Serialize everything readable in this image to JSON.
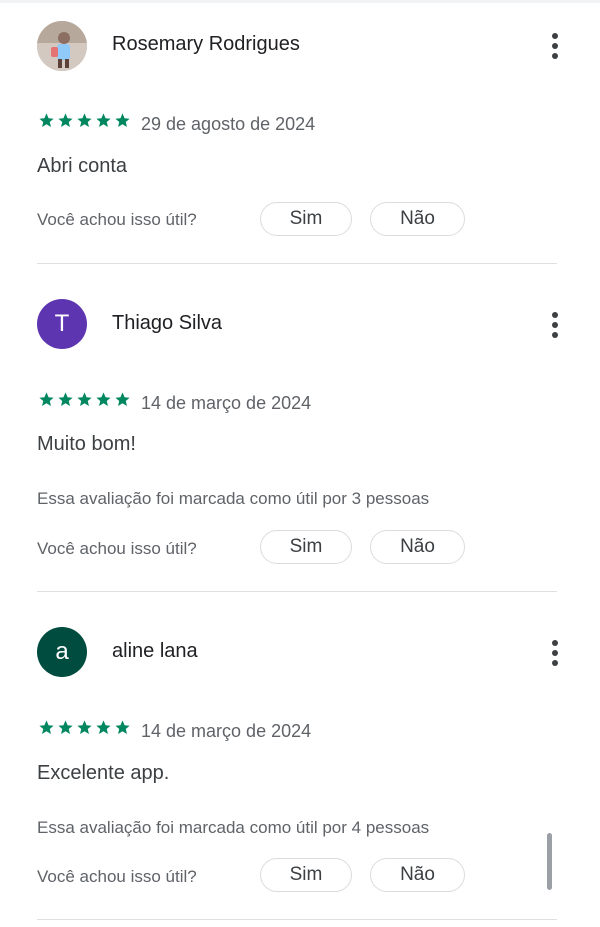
{
  "colors": {
    "star": "#01875f",
    "avatar_thiago": "#5e35b1",
    "avatar_aline": "#004d40",
    "text_secondary": "#5f6368"
  },
  "reviews": [
    {
      "author": "Rosemary Rodrigues",
      "avatar_type": "photo",
      "rating": 5,
      "date": "29 de agosto de 2024",
      "text": "Abri conta",
      "helpful_count_text": "",
      "helpful_question": "Você achou isso útil?",
      "yes_label": "Sim",
      "no_label": "Não"
    },
    {
      "author": "Thiago Silva",
      "avatar_letter": "T",
      "rating": 5,
      "date": "14 de março de 2024",
      "text": "Muito bom!",
      "helpful_count_text": "Essa avaliação foi marcada como útil por 3 pessoas",
      "helpful_question": "Você achou isso útil?",
      "yes_label": "Sim",
      "no_label": "Não"
    },
    {
      "author": "aline lana",
      "avatar_letter": "a",
      "rating": 5,
      "date": "14 de março de 2024",
      "text": "Excelente app.",
      "helpful_count_text": "Essa avaliação foi marcada como útil por 4 pessoas",
      "helpful_question": "Você achou isso útil?",
      "yes_label": "Sim",
      "no_label": "Não"
    }
  ],
  "icons": {
    "menu": "more-vert-icon",
    "star": "star-icon"
  }
}
